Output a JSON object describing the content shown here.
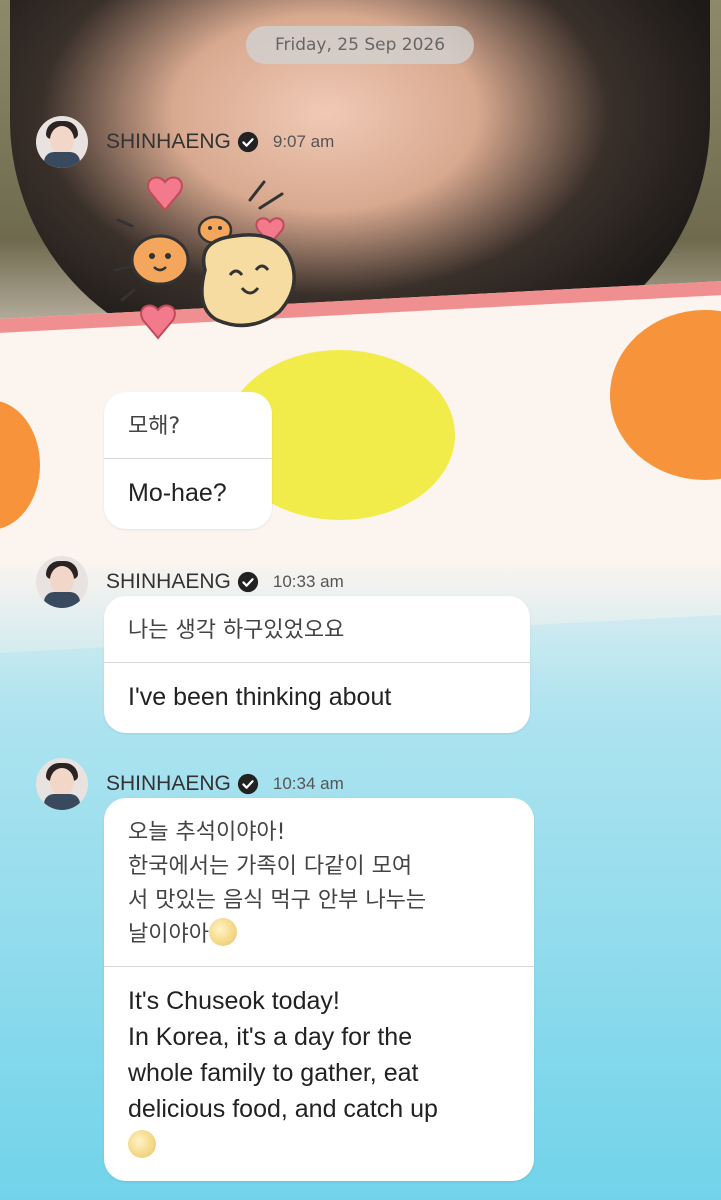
{
  "date_pill": "Friday, 25 Sep 2026",
  "messages": [
    {
      "sender": "SHINHAENG",
      "time": "9:07 am",
      "sticker": "heart-bears-sticker",
      "ko": "모해?",
      "en": "Mo-hae?"
    },
    {
      "sender": "SHINHAENG",
      "time": "10:33 am",
      "ko": "나는        생각 하구있었오요",
      "en": "I've been thinking about"
    },
    {
      "sender": "SHINHAENG",
      "time": "10:34 am",
      "ko": "오늘 추석이야아!\n한국에서는 가족이 다같이 모여\n서 맛있는 음식 먹구 안부 나누는\n날이야아",
      "en": "It's Chuseok today!\nIn Korea, it's a day for the\nwhole family to gather, eat\ndelicious food, and catch up"
    }
  ],
  "icons": {
    "verified": "verified-badge-icon",
    "moon": "full-moon-emoji-icon"
  },
  "colors": {
    "bubble": "#ffffff",
    "date_pill": "#d2d2d2",
    "text": "#222222"
  }
}
